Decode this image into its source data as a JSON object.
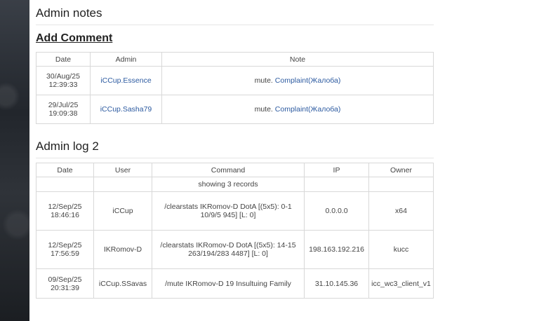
{
  "admin_notes": {
    "title": "Admin notes",
    "add_comment": "Add Comment",
    "headers": [
      "Date",
      "Admin",
      "Note"
    ],
    "rows": [
      {
        "date_line1": "30/Aug/25",
        "date_line2": "12:39:33",
        "admin": "iCCup.Essence",
        "note_prefix": "mute. ",
        "note_link": "Complaint(Жалоба)"
      },
      {
        "date_line1": "29/Jul/25",
        "date_line2": "19:09:38",
        "admin": "iCCup.Sasha79",
        "note_prefix": "mute. ",
        "note_link": "Complaint(Жалоба)"
      }
    ]
  },
  "admin_log": {
    "title": "Admin log 2",
    "headers": [
      "Date",
      "User",
      "Command",
      "IP",
      "Owner"
    ],
    "records_text": "showing 3 records",
    "rows": [
      {
        "date_line1": "12/Sep/25",
        "date_line2": "18:46:16",
        "user": "iCCup",
        "command": "/clearstats IKRomov-D DotA [(5x5): 0-1 10/9/5 945] [L: 0]",
        "ip": "0.0.0.0",
        "owner": "x64"
      },
      {
        "date_line1": "12/Sep/25",
        "date_line2": "17:56:59",
        "user": "IKRomov-D",
        "command": "/clearstats IKRomov-D DotA [(5x5): 14-15 263/194/283 4487] [L: 0]",
        "ip": "198.163.192.216",
        "owner": "kucc"
      },
      {
        "date_line1": "09/Sep/25",
        "date_line2": "20:31:39",
        "user": "iCCup.SSavas",
        "command": "/mute IKRomov-D 19 Insultuing Family",
        "ip": "31.10.145.36",
        "owner": "icc_wc3_client_v1"
      }
    ]
  },
  "colors": {
    "link": "#2c5aa0",
    "border": "#d8d8d8"
  }
}
